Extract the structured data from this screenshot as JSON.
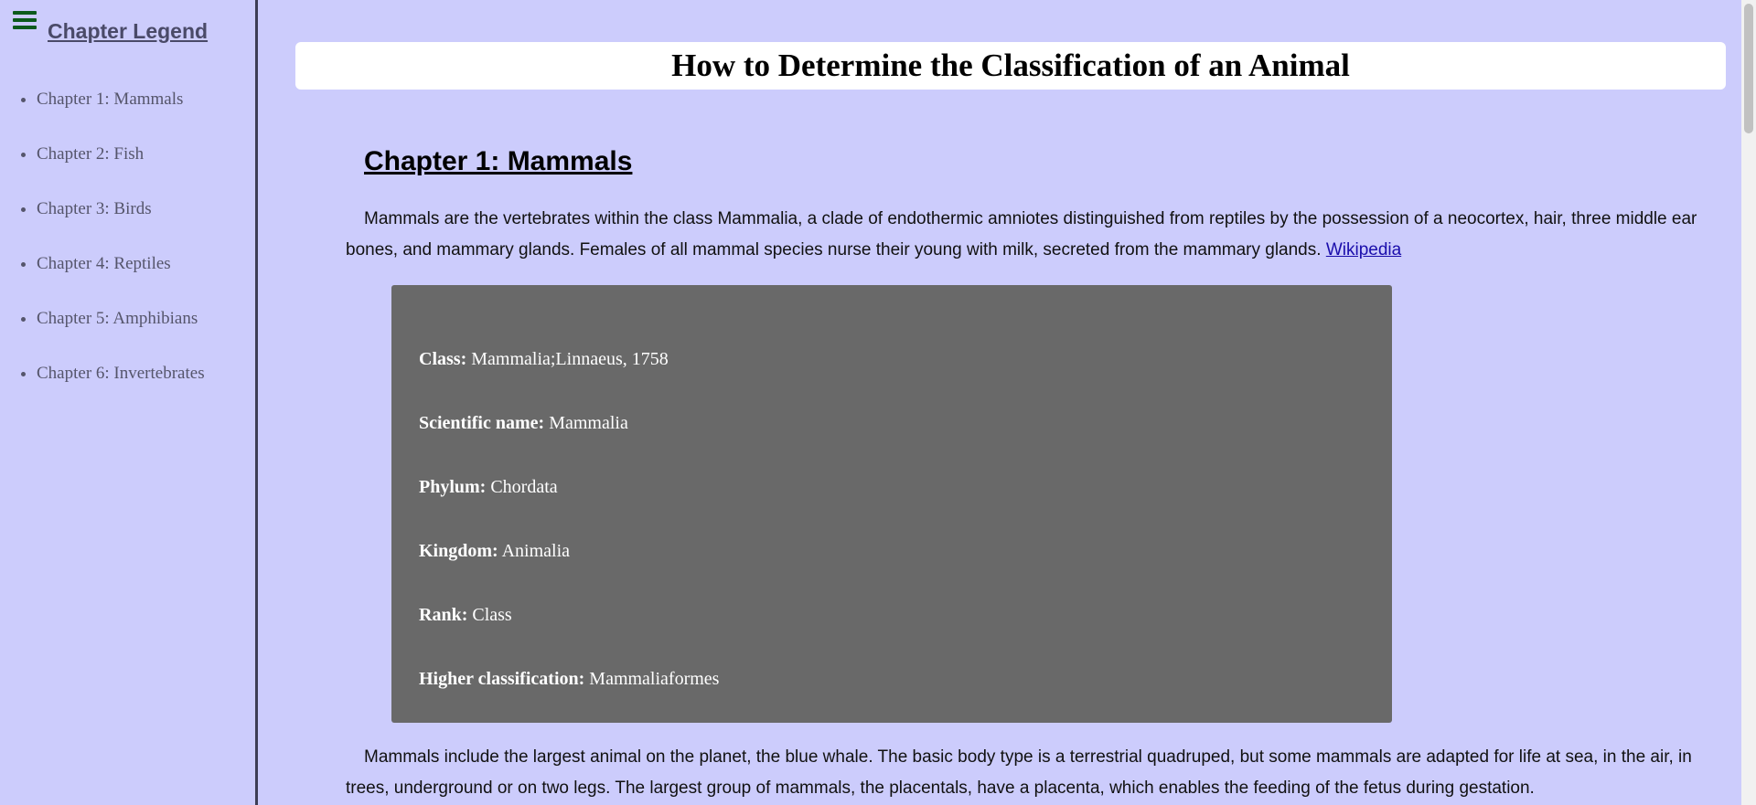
{
  "sidebar": {
    "title": "Chapter Legend",
    "items": [
      {
        "label": "Chapter 1: Mammals"
      },
      {
        "label": "Chapter 2: Fish"
      },
      {
        "label": "Chapter 3: Birds"
      },
      {
        "label": "Chapter 4: Reptiles"
      },
      {
        "label": "Chapter 5: Amphibians"
      },
      {
        "label": "Chapter 6: Invertebrates"
      }
    ],
    "menu_icon": "hamburger-menu-icon"
  },
  "main": {
    "title": "How to Determine the Classification of an Animal",
    "chapter": {
      "heading": "Chapter 1: Mammals",
      "intro_text": "Mammals are the vertebrates within the class Mammalia, a clade of endothermic amniotes distinguished from reptiles by the possession of a neocortex, hair, three middle ear bones, and mammary glands. Females of all mammal species nurse their young with milk, secreted from the mammary glands. ",
      "intro_link": "Wikipedia",
      "info": [
        {
          "label": "Class:",
          "value": " Mammalia;Linnaeus, 1758"
        },
        {
          "label": "Scientific name:",
          "value": " Mammalia"
        },
        {
          "label": "Phylum:",
          "value": " Chordata"
        },
        {
          "label": "Kingdom:",
          "value": " Animalia"
        },
        {
          "label": "Rank:",
          "value": " Class"
        },
        {
          "label": "Higher classification:",
          "value": " Mammaliaformes"
        }
      ],
      "body_text": "Mammals include the largest animal on the planet, the blue whale. The basic body type is a terrestrial quadruped, but some mammals are adapted for life at sea, in the air, in trees, underground or on two legs. The largest group of mammals, the placentals, have a placenta, which enables the feeding of the fetus during gestation."
    }
  },
  "colors": {
    "background": "#ccccfc",
    "info_box": "#696969",
    "menu_icon": "#0c5a1c",
    "link": "#1a0dab"
  }
}
